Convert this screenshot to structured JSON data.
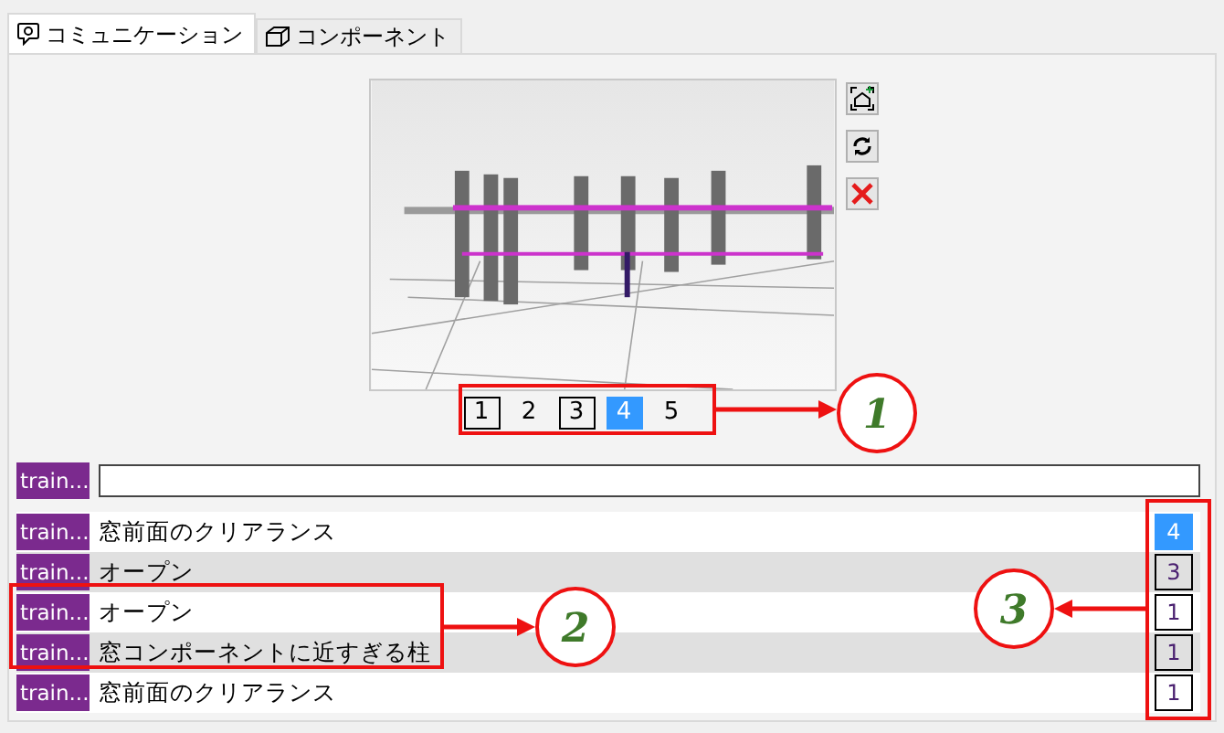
{
  "tabs": [
    {
      "label": "コミュニケーション",
      "selected": true
    },
    {
      "label": "コンポーネント",
      "selected": false
    }
  ],
  "viewer": {
    "buttons": [
      {
        "kind": "home"
      },
      {
        "kind": "refresh"
      },
      {
        "kind": "close"
      }
    ]
  },
  "pager": [
    {
      "label": "1",
      "outlined": true,
      "selected": false
    },
    {
      "label": "2",
      "outlined": false,
      "selected": false
    },
    {
      "label": "3",
      "outlined": true,
      "selected": false
    },
    {
      "label": "4",
      "outlined": false,
      "selected": true
    },
    {
      "label": "5",
      "outlined": false,
      "selected": false
    }
  ],
  "comment_input": {
    "tag": "train..."
  },
  "rows": [
    {
      "tag": "train...",
      "text": "窓前面のクリアランス",
      "count": "4",
      "selected": true
    },
    {
      "tag": "train...",
      "text": "オープン",
      "count": "3",
      "selected": false
    },
    {
      "tag": "train...",
      "text": "オープン",
      "count": "1",
      "selected": false
    },
    {
      "tag": "train...",
      "text": "窓コンポーネントに近すぎる柱",
      "count": "1",
      "selected": false
    },
    {
      "tag": "train...",
      "text": "窓前面のクリアランス",
      "count": "1",
      "selected": false
    }
  ],
  "callouts": [
    {
      "number": "1"
    },
    {
      "number": "2"
    },
    {
      "number": "3"
    }
  ]
}
